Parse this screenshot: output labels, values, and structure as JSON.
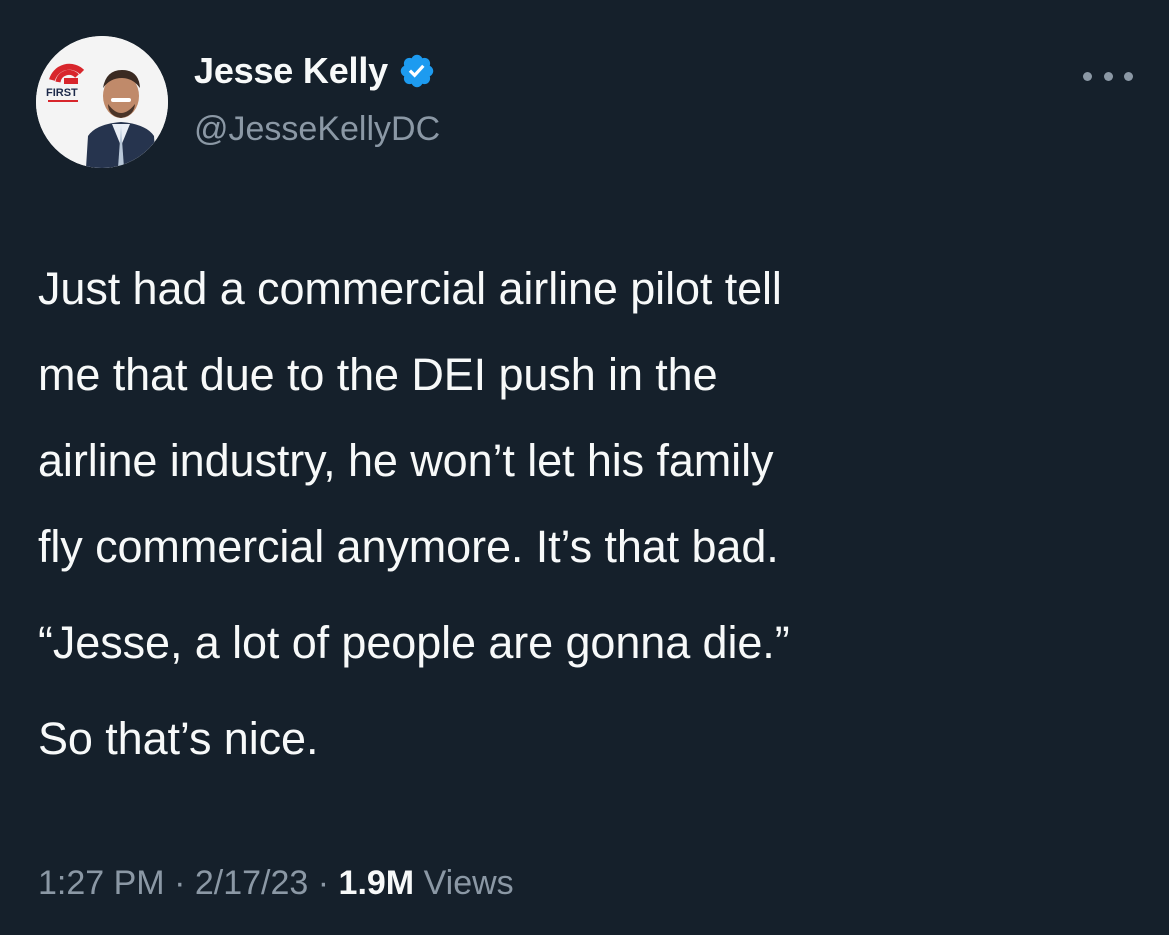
{
  "user": {
    "display_name": "Jesse Kelly",
    "handle": "@JesseKellyDC",
    "verified": true,
    "avatar_badge_text": "FIRST"
  },
  "tweet": {
    "lines": [
      "Just had a commercial airline pilot tell",
      "me that due to the DEI push in the",
      "airline industry, he won’t let his family",
      "fly commercial anymore. It’s that bad.",
      "“Jesse, a lot of people are gonna die.”",
      "So that’s nice."
    ]
  },
  "meta": {
    "time": "1:27 PM",
    "separator": "·",
    "date": "2/17/23",
    "views_count": "1.9M",
    "views_label": "Views"
  },
  "colors": {
    "background": "#15202b",
    "text_primary": "#f7f9f9",
    "text_secondary": "#8b98a5",
    "verified_blue": "#1d9bf0"
  },
  "icons": {
    "verified": "verified-badge-icon",
    "more": "more-horizontal-icon"
  }
}
